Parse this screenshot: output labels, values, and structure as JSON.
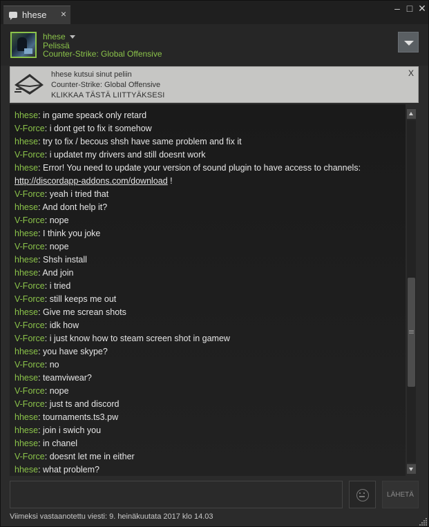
{
  "window": {
    "tab_title": "hhese",
    "tab_close": "×",
    "minimize": "–",
    "maximize": "□",
    "close": "✕"
  },
  "header": {
    "name": "hhese",
    "status": "Pelissä",
    "game": "Counter-Strike: Global Offensive"
  },
  "invite": {
    "line1": "hhese kutsui sinut peliin",
    "line2": "Counter-Strike: Global Offensive",
    "line3": "KLIKKAA TÄSTÄ LIITTYÄKSESI",
    "close": "X"
  },
  "messages": [
    {
      "sender": "hhese",
      "text": ": in game speack only retard"
    },
    {
      "sender": "V-Force",
      "text": ": i dont get to fix it somehow"
    },
    {
      "sender": "hhese",
      "text": ": try to fix / becous shsh have same problem and fix it"
    },
    {
      "sender": "V-Force",
      "text": ": i updatet my drivers and still doesnt work"
    },
    {
      "sender": "hhese",
      "text": ": Error! You need to update your version of sound plugin to have access to channels:"
    },
    {
      "sender": "",
      "text": " !",
      "link": "http://discordapp-addons.com/download"
    },
    {
      "sender": "V-Force",
      "text": ": yeah i tried that"
    },
    {
      "sender": "hhese",
      "text": ": And dont help it?"
    },
    {
      "sender": "V-Force",
      "text": ": nope"
    },
    {
      "sender": "hhese",
      "text": ": I think you joke"
    },
    {
      "sender": "V-Force",
      "text": ": nope"
    },
    {
      "sender": "hhese",
      "text": ": Shsh install"
    },
    {
      "sender": "hhese",
      "text": ": And join"
    },
    {
      "sender": "V-Force",
      "text": ": i tried"
    },
    {
      "sender": "V-Force",
      "text": ": still keeps me out"
    },
    {
      "sender": "hhese",
      "text": ": Give me screan shots"
    },
    {
      "sender": "V-Force",
      "text": ": idk how"
    },
    {
      "sender": "V-Force",
      "text": ": i just know how to steam screen shot in gamew"
    },
    {
      "sender": "hhese",
      "text": ": you have skype?"
    },
    {
      "sender": "V-Force",
      "text": ": no"
    },
    {
      "sender": "hhese",
      "text": ": teamviwear?"
    },
    {
      "sender": "V-Force",
      "text": ": nope"
    },
    {
      "sender": "V-Force",
      "text": ": just ts and discord"
    },
    {
      "sender": "hhese",
      "text": ": tournaments.ts3.pw"
    },
    {
      "sender": "hhese",
      "text": ": join i swich you"
    },
    {
      "sender": "hhese",
      "text": ": in chanel"
    },
    {
      "sender": "V-Force",
      "text": ": doesnt let me in either"
    },
    {
      "sender": "hhese",
      "text": ": what problem?"
    }
  ],
  "input": {
    "value": "",
    "send_label": "LÄHETÄ"
  },
  "footer": {
    "text": "Viimeksi vastaanotettu viesti: 9. heinäkuutata 2017 klo 14.03"
  },
  "colors": {
    "accent": "#8bc34a",
    "text": "#e6e6e6",
    "background": "#2b2b2b"
  },
  "icons": {
    "tab": "chat-bubble-icon",
    "invite": "envelope-icon",
    "emoji": "emoji-face-icon",
    "menu": "chevron-down-icon"
  }
}
